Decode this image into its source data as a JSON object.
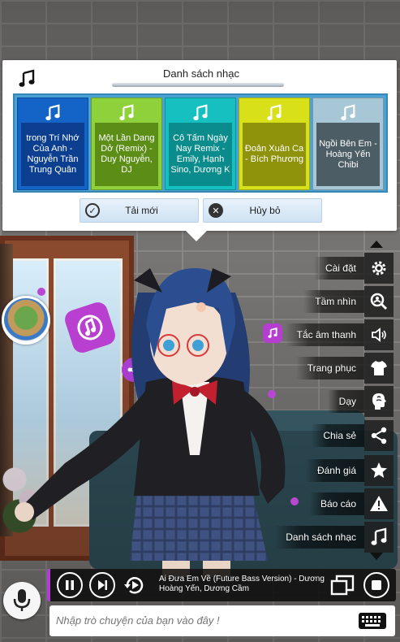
{
  "dialog": {
    "title": "Danh sách nhạc",
    "icon": "music-note-icon",
    "songs": [
      {
        "title": "trong Trí Nhớ Của Anh - Nguyễn Trần Trung Quân",
        "color": "#1464c8",
        "box_color": "#0c3f8f",
        "text_color": "#ffffff"
      },
      {
        "title": "Một Lần Dang Dở (Remix) - Duy Nguyễn, DJ",
        "color": "#8fd13a",
        "box_color": "#5c8e17",
        "text_color": "#ffffff"
      },
      {
        "title": "Cô Tấm Ngày Nay Remix - Emily, Hạnh Sino, Dương K",
        "color": "#17c0c0",
        "box_color": "#0a8c8c",
        "text_color": "#ffffff"
      },
      {
        "title": "Đoản Xuân Ca - Bích Phương",
        "color": "#d8e019",
        "box_color": "#8f930b",
        "text_color": "#ffffff"
      },
      {
        "title": "Ngồi Bên Em - Hoàng Yến Chibi",
        "color": "#a7c7d6",
        "box_color": "#4d5d66",
        "text_color": "#ffffff"
      }
    ],
    "reload_button": "Tải mới",
    "cancel_button": "Hủy bỏ"
  },
  "menu": {
    "items": [
      {
        "label": "Cài đặt",
        "icon": "gear-icon"
      },
      {
        "label": "Tầm nhìn",
        "icon": "zoom-icon"
      },
      {
        "label": "Tắc âm thanh",
        "icon": "speaker-icon"
      },
      {
        "label": "Trang phục",
        "icon": "shirt-icon"
      },
      {
        "label": "Dạy",
        "icon": "brain-icon"
      },
      {
        "label": "Chia sẻ",
        "icon": "share-icon"
      },
      {
        "label": "Đánh giá",
        "icon": "star-icon"
      },
      {
        "label": "Báo cáo",
        "icon": "warning-icon"
      },
      {
        "label": "Danh sách nhạc",
        "icon": "music-list-icon"
      }
    ]
  },
  "player": {
    "now_playing": "Ai Đưa Em Về (Future Bass Version) - Dương Hoàng Yến, Dương Cầm",
    "accent": "#b23dd6"
  },
  "chat": {
    "placeholder": "Nhập trò chuyện của bạn vào đây !"
  }
}
